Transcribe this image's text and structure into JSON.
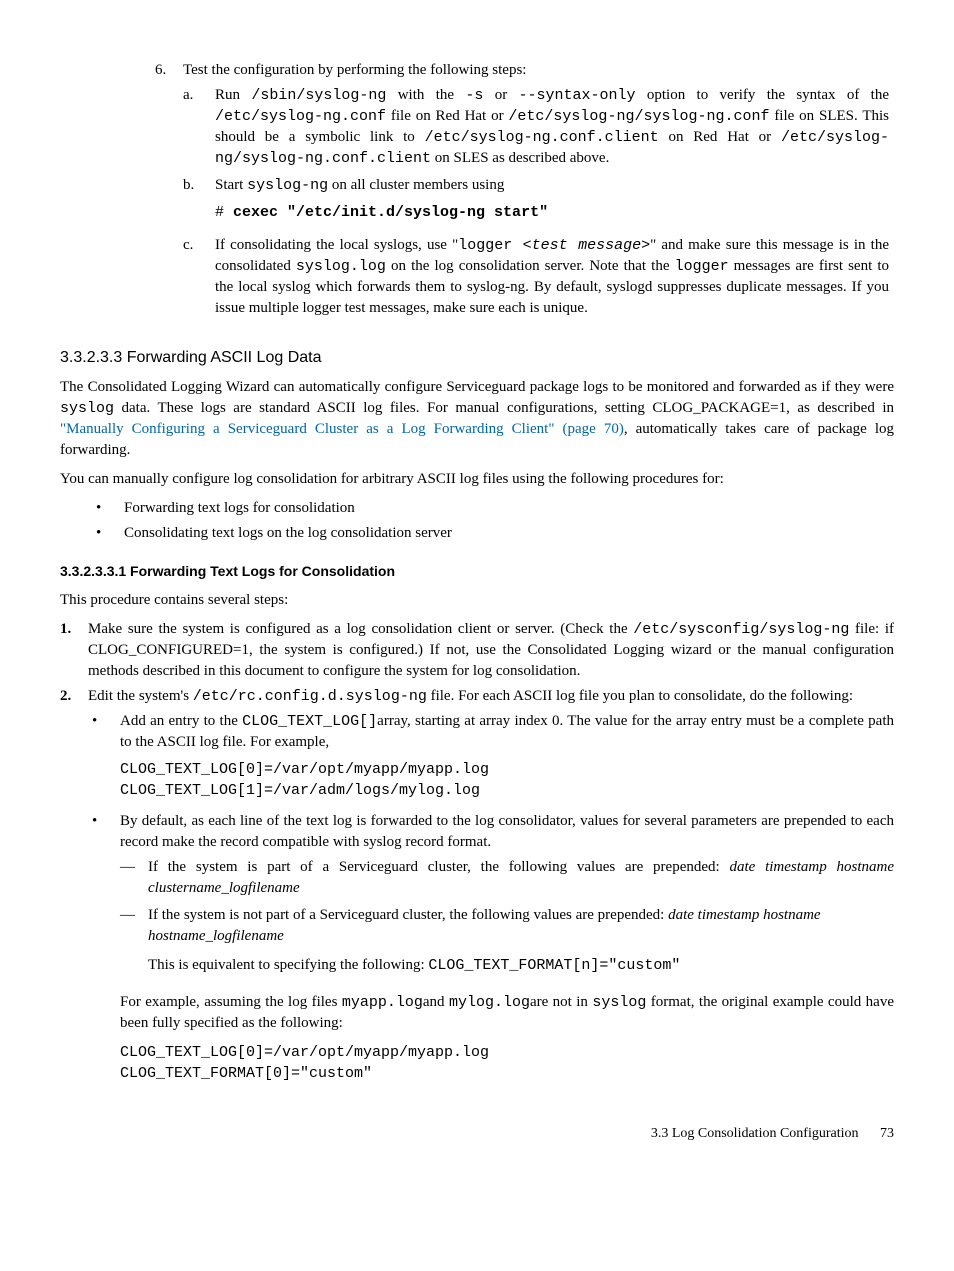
{
  "step6": {
    "num": "6.",
    "text": "Test the configuration by performing the following steps:",
    "a": {
      "alpha": "a.",
      "t1": "Run ",
      "c1": "/sbin/syslog-ng",
      "t2": " with the ",
      "c2": "-s",
      "t3": " or ",
      "c3": "--syntax-only",
      "t4": " option to verify the syntax of the ",
      "c4": "/etc/syslog-ng.conf",
      "t5": " file on Red Hat or ",
      "c5": "/etc/syslog-ng/syslog-ng.conf",
      "t6": " file on SLES. This should be a symbolic link to ",
      "c6": "/etc/syslog-ng.conf.client",
      "t7": " on Red Hat or ",
      "c7": "/etc/syslog-ng/syslog-ng.conf.client",
      "t8": " on SLES as described above."
    },
    "b": {
      "alpha": "b.",
      "t1": "Start ",
      "c1": "syslog-ng",
      "t2": " on all cluster members using",
      "cmd_hash": "# ",
      "cmd": "cexec \"/etc/init.d/syslog-ng start\""
    },
    "c": {
      "alpha": "c.",
      "t1": "If consolidating the local syslogs, use \"",
      "c1": "logger ",
      "c1i": "<test message>",
      "t2": "\" and make sure this message is in the consolidated ",
      "c2": "syslog.log",
      "t3": " on the log consolidation server. Note that the ",
      "c3": "logger",
      "t4": " messages are first sent to the local syslog which forwards them to syslog-ng. By default, syslogd suppresses duplicate messages. If you issue multiple logger test messages, make sure each is unique."
    }
  },
  "sec33233": {
    "title": "3.3.2.3.3 Forwarding ASCII Log Data",
    "p1": {
      "t1": "The Consolidated Logging Wizard can automatically configure Serviceguard package logs to be monitored and forwarded as if they were ",
      "c1": "syslog",
      "t2": " data. These logs are standard ASCII log files. For manual configurations, setting CLOG_PACKAGE=1, as described in ",
      "link": "\"Manually Configuring a Serviceguard Cluster as a Log Forwarding Client\" (page 70)",
      "t3": ", automatically takes care of package log forwarding."
    },
    "p2": "You can manually configure log consolidation for arbitrary ASCII log files using the following procedures for:",
    "b1": "Forwarding text logs for consolidation",
    "b2": "Consolidating text logs on the log consolidation server"
  },
  "sec332331": {
    "title": "3.3.2.3.3.1 Forwarding Text Logs for Consolidation",
    "intro": "This procedure contains several steps:",
    "s1": {
      "num": "1.",
      "t1": "Make sure the system is configured as a log consolidation client or server. (Check the ",
      "c1": "/etc/sysconfig/syslog-ng",
      "t2": " file: if CLOG_CONFIGURED=1, the system is configured.) If not, use the Consolidated Logging wizard or the manual configuration methods described in this document to configure the system for log consolidation."
    },
    "s2": {
      "num": "2.",
      "t1": "Edit the system's ",
      "c1": "/etc/rc.config.d.syslog-ng",
      "t2": " file. For each ASCII log file you plan to consolidate, do the following:",
      "b1": {
        "t1": "Add an entry to the ",
        "c1": "CLOG_TEXT_LOG[]",
        "t2": "array, starting at array index 0. The value for the array entry must be a complete path to the ASCII log file. For example,",
        "code": "CLOG_TEXT_LOG[0]=/var/opt/myapp/myapp.log\nCLOG_TEXT_LOG[1]=/var/adm/logs/mylog.log"
      },
      "b2": {
        "t1": "By default, as each line of the text log is forwarded to the log consolidator, values for several parameters are prepended to each record make the record compatible with syslog record format.",
        "d1": {
          "t1": "If the system is part of a Serviceguard cluster, the following values are prepended: ",
          "i1": "date timestamp hostname clustername_logfilename"
        },
        "d2": {
          "t1": "If the system is not part of a Serviceguard cluster, the following values are prepended: ",
          "i1": "date timestamp hostname hostname_logfilename",
          "t2": "This is equivalent to specifying the following: ",
          "c1": "CLOG_TEXT_FORMAT[n]=\"custom\""
        },
        "post": {
          "t1": "For example, assuming the log files ",
          "c1": "myapp.log",
          "t2": "and ",
          "c2": "mylog.log",
          "t3": "are not in ",
          "c3": "syslog",
          "t4": " format, the original example could have been fully specified as the following:",
          "code": "CLOG_TEXT_LOG[0]=/var/opt/myapp/myapp.log\nCLOG_TEXT_FORMAT[0]=\"custom\""
        }
      }
    }
  },
  "footer": {
    "section": "3.3 Log Consolidation Configuration",
    "page": "73"
  }
}
